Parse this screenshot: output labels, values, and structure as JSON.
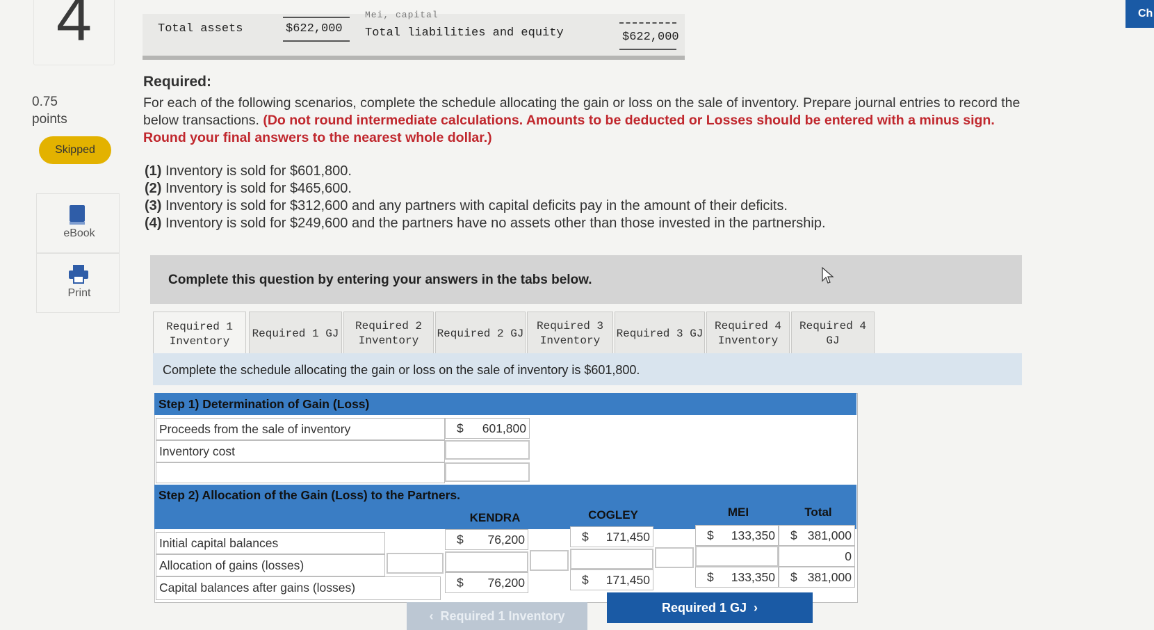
{
  "question": {
    "number": "4",
    "points_value": "0.75",
    "points_label": "points",
    "status": "Skipped"
  },
  "rail": {
    "ebook": "eBook",
    "print": "Print"
  },
  "balance": {
    "total_assets_label": "Total assets",
    "total_assets_value": "$622,000",
    "partial_label": "Mei, capital",
    "total_liab_label": "Total liabilities and equity",
    "total_liab_value": "$622,000"
  },
  "required": {
    "title": "Required:",
    "body_plain": "For each of the following scenarios, complete the schedule allocating the gain or loss on the sale of inventory. Prepare journal entries to record the below transactions.",
    "body_red": "(Do not round intermediate calculations. Amounts to be deducted or Losses should be entered with a minus sign. Round your final answers to the nearest whole dollar.)",
    "scenarios": [
      {
        "num": "(1)",
        "text": "Inventory is sold for $601,800."
      },
      {
        "num": "(2)",
        "text": "Inventory is sold for $465,600."
      },
      {
        "num": "(3)",
        "text": "Inventory is sold for $312,600 and any partners with capital deficits pay in the amount of their deficits."
      },
      {
        "num": "(4)",
        "text": "Inventory is sold for $249,600 and the partners have no assets other than those invested in the partnership."
      }
    ]
  },
  "instruction": "Complete this question by entering your answers in the tabs below.",
  "tabs": [
    {
      "l1": "Required 1",
      "l2": "Inventory"
    },
    {
      "l1": "Required 1 GJ",
      "l2": ""
    },
    {
      "l1": "Required 2",
      "l2": "Inventory"
    },
    {
      "l1": "Required 2 GJ",
      "l2": ""
    },
    {
      "l1": "Required 3",
      "l2": "Inventory"
    },
    {
      "l1": "Required 3 GJ",
      "l2": ""
    },
    {
      "l1": "Required 4",
      "l2": "Inventory"
    },
    {
      "l1": "Required 4 GJ",
      "l2": ""
    }
  ],
  "subinstruction": "Complete the schedule allocating the gain or loss on the sale of inventory is $601,800.",
  "schedule": {
    "step1_title": "Step 1) Determination of Gain (Loss)",
    "proceeds_label": "Proceeds from the sale of inventory",
    "proceeds_dollar": "$",
    "proceeds_value": "601,800",
    "inventory_cost_label": "Inventory cost",
    "step2_title": "Step 2) Allocation of the Gain (Loss) to the Partners.",
    "columns": [
      "KENDRA",
      "COGLEY",
      "MEI",
      "Total"
    ],
    "rows": {
      "initial_label": "Initial capital balances",
      "allocation_label": "Allocation of gains (losses)",
      "after_label": "Capital balances after gains (losses)"
    },
    "initial": {
      "kendra": "76,200",
      "cogley": "171,450",
      "mei": "133,350",
      "total": "381,000"
    },
    "allocation_total": "0",
    "after": {
      "kendra": "76,200",
      "cogley": "171,450",
      "mei": "133,350",
      "total": "381,000"
    },
    "dollar": "$"
  },
  "nav": {
    "prev": "Required 1 Inventory",
    "next": "Required 1 GJ"
  },
  "check_label": "Ch"
}
